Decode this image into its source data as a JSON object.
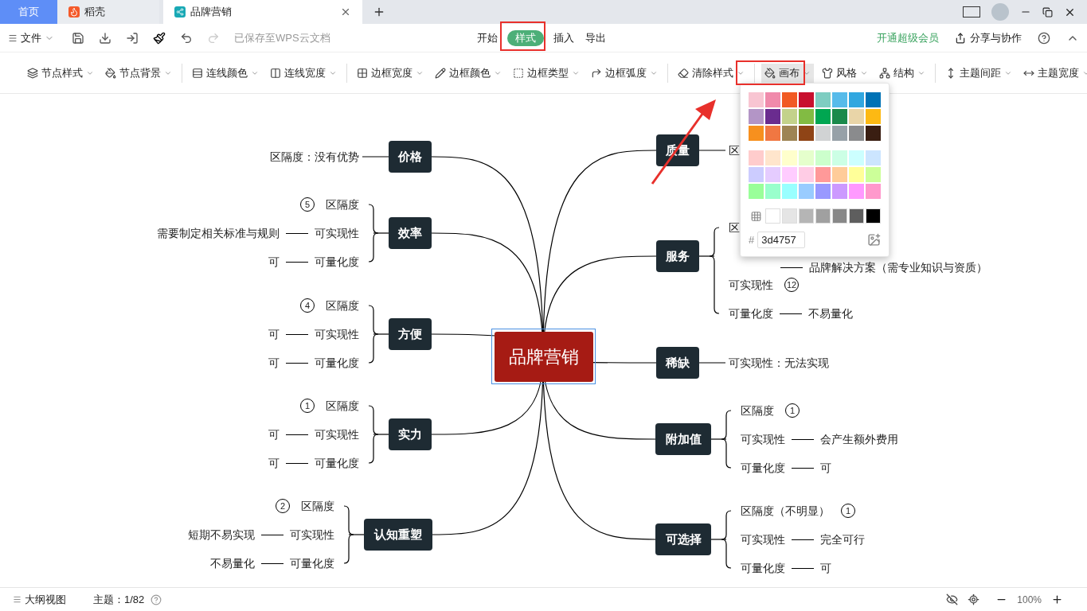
{
  "tabs": [
    {
      "label": "首页",
      "kind": "home",
      "selected": false
    },
    {
      "label": "稻壳",
      "kind": "docer",
      "selected": false
    },
    {
      "label": "品牌营销",
      "kind": "doc",
      "selected": true
    }
  ],
  "menu": {
    "file": "文件",
    "saved": "已保存至WPS云文档",
    "tabs": [
      {
        "label": "开始",
        "selected": false
      },
      {
        "label": "样式",
        "selected": true
      },
      {
        "label": "插入",
        "selected": false
      },
      {
        "label": "导出",
        "selected": false
      }
    ],
    "vip": "开通超级会员",
    "share": "分享与协作"
  },
  "toolbar": {
    "groups": [
      [
        {
          "label": "节点样式",
          "selected": false
        },
        {
          "label": "节点背景",
          "selected": false
        }
      ],
      [
        {
          "label": "连线颜色",
          "selected": false
        },
        {
          "label": "连线宽度",
          "selected": false
        }
      ],
      [
        {
          "label": "边框宽度",
          "selected": false
        },
        {
          "label": "边框颜色",
          "selected": false
        },
        {
          "label": "边框类型",
          "selected": false
        },
        {
          "label": "边框弧度",
          "selected": false
        }
      ],
      [
        {
          "label": "清除样式",
          "selected": false
        }
      ],
      [
        {
          "label": "画布",
          "selected": true
        },
        {
          "label": "风格",
          "selected": false
        },
        {
          "label": "结构",
          "selected": false
        }
      ],
      [
        {
          "label": "主题间距",
          "selected": false
        },
        {
          "label": "主题宽度",
          "selected": false
        }
      ]
    ]
  },
  "palette": {
    "rows": [
      [
        {
          "color": "#f8c5d2"
        },
        {
          "color": "#f08aab"
        },
        {
          "color": "#f15a24"
        },
        {
          "color": "#c8102e"
        },
        {
          "color": "#7ecdc1"
        },
        {
          "color": "#56bbea"
        },
        {
          "color": "#31a7e0"
        },
        {
          "color": "#0072b5"
        }
      ],
      [
        {
          "color": "#b395c6"
        },
        {
          "color": "#6a2c8f"
        },
        {
          "color": "#c3d28b"
        },
        {
          "color": "#82bb43"
        },
        {
          "color": "#00a651"
        },
        {
          "color": "#1a8a4b"
        },
        {
          "color": "#e9d5a8"
        },
        {
          "color": "#fdb913"
        }
      ],
      [
        {
          "color": "#f7901e"
        },
        {
          "color": "#f07742"
        },
        {
          "color": "#9e8454"
        },
        {
          "color": "#8f4416"
        },
        {
          "color": "#d1d3d4"
        },
        {
          "color": "#97a1a8"
        },
        {
          "color": "#8a8b8d"
        },
        {
          "color": "#3a1e12"
        }
      ]
    ],
    "light_rows": [
      [
        {
          "color": "#ffcccc"
        },
        {
          "color": "#ffe5cc"
        },
        {
          "color": "#ffffcc"
        },
        {
          "color": "#e5ffcc"
        },
        {
          "color": "#ccffcc"
        },
        {
          "color": "#ccffe5"
        },
        {
          "color": "#ccffff"
        },
        {
          "color": "#cce5ff"
        }
      ],
      [
        {
          "color": "#ccccff"
        },
        {
          "color": "#e5ccff"
        },
        {
          "color": "#ffccff"
        },
        {
          "color": "#ffcce5"
        },
        {
          "color": "#ff9999"
        },
        {
          "color": "#ffcc99"
        },
        {
          "color": "#ffff99"
        },
        {
          "color": "#ccff99"
        }
      ],
      [
        {
          "color": "#99ff99"
        },
        {
          "color": "#99ffcc"
        },
        {
          "color": "#99ffff"
        },
        {
          "color": "#99ccff"
        },
        {
          "color": "#9999ff"
        },
        {
          "color": "#cc99ff"
        },
        {
          "color": "#ff99ff"
        },
        {
          "color": "#ff99cc"
        }
      ]
    ],
    "grays": [
      {
        "color": "#ffffff"
      },
      {
        "color": "#e5e5e5"
      },
      {
        "color": "#b5b5b5"
      },
      {
        "color": "#a0a0a0"
      },
      {
        "color": "#888888"
      },
      {
        "color": "#5e5e5e"
      },
      {
        "color": "#000000"
      }
    ],
    "hash": "#",
    "hex": "3d4757"
  },
  "mindmap": {
    "center": "品牌营销",
    "left": [
      {
        "label": "价格",
        "children": [
          {
            "label": "区隔度：没有优势"
          }
        ]
      },
      {
        "label": "效率",
        "children": [
          {
            "label": "区隔度",
            "marker": "5"
          },
          {
            "label": "可实现性",
            "value": "需要制定相关标准与规则"
          },
          {
            "label": "可量化度",
            "value": "可"
          }
        ]
      },
      {
        "label": "方便",
        "children": [
          {
            "label": "区隔度",
            "marker": "4"
          },
          {
            "label": "可实现性",
            "value": "可"
          },
          {
            "label": "可量化度",
            "value": "可"
          }
        ]
      },
      {
        "label": "实力",
        "children": [
          {
            "label": "区隔度",
            "marker": "1"
          },
          {
            "label": "可实现性",
            "value": "可"
          },
          {
            "label": "可量化度",
            "value": "可"
          }
        ]
      },
      {
        "label": "认知重塑",
        "children": [
          {
            "label": "区隔度",
            "marker": "2"
          },
          {
            "label": "可实现性",
            "value": "短期不易实现"
          },
          {
            "label": "可量化度",
            "value": "不易量化"
          }
        ]
      }
    ],
    "right": [
      {
        "label": "质量",
        "children": [
          {
            "label": "区"
          }
        ]
      },
      {
        "label": "服务",
        "children": [
          {
            "label": "区"
          },
          {
            "value": "品牌解决方案（需专业知识与资质）"
          },
          {
            "label": "可实现性",
            "marker": "12"
          },
          {
            "label": "可量化度",
            "value": "不易量化"
          }
        ]
      },
      {
        "label": "稀缺",
        "children": [
          {
            "label": "可实现性：无法实现"
          }
        ]
      },
      {
        "label": "附加值",
        "children": [
          {
            "label": "区隔度",
            "marker": "1"
          },
          {
            "label": "可实现性",
            "value": "会产生额外费用"
          },
          {
            "label": "可量化度",
            "value": "可"
          }
        ]
      },
      {
        "label": "可选择",
        "children": [
          {
            "label": "区隔度（不明显）",
            "marker": "1"
          },
          {
            "label": "可实现性",
            "value": "完全可行"
          },
          {
            "label": "可量化度",
            "value": "可"
          }
        ]
      }
    ]
  },
  "status": {
    "outline": "大纲视图",
    "topics": "主题：1/82",
    "zoom": "100%"
  }
}
